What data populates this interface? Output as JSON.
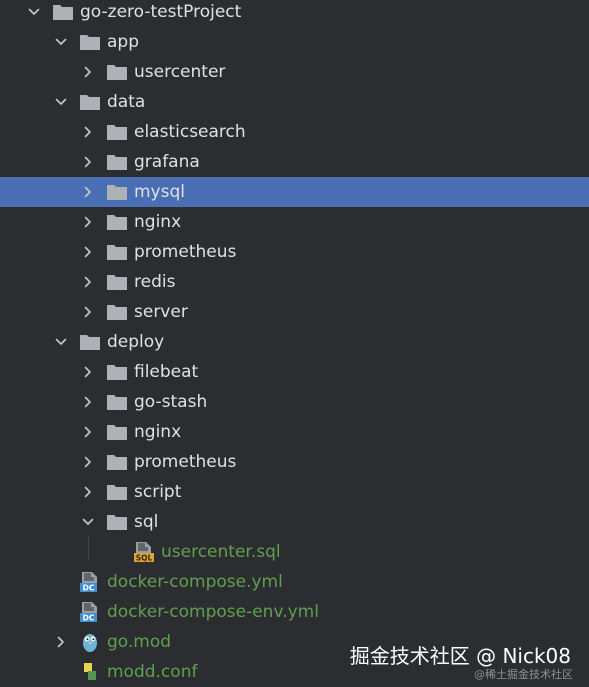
{
  "tree": [
    {
      "label": "go-zero-testProject",
      "depth": 0,
      "expanded": true,
      "type": "folder",
      "icon": "folder-icon"
    },
    {
      "label": "app",
      "depth": 1,
      "expanded": true,
      "type": "folder",
      "icon": "folder-icon"
    },
    {
      "label": "usercenter",
      "depth": 2,
      "expanded": false,
      "type": "folder",
      "icon": "folder-icon"
    },
    {
      "label": "data",
      "depth": 1,
      "expanded": true,
      "type": "folder",
      "icon": "folder-icon"
    },
    {
      "label": "elasticsearch",
      "depth": 2,
      "expanded": false,
      "type": "folder",
      "icon": "folder-icon"
    },
    {
      "label": "grafana",
      "depth": 2,
      "expanded": false,
      "type": "folder",
      "icon": "folder-icon"
    },
    {
      "label": "mysql",
      "depth": 2,
      "expanded": false,
      "type": "folder",
      "icon": "folder-icon",
      "selected": true
    },
    {
      "label": "nginx",
      "depth": 2,
      "expanded": false,
      "type": "folder",
      "icon": "folder-icon"
    },
    {
      "label": "prometheus",
      "depth": 2,
      "expanded": false,
      "type": "folder",
      "icon": "folder-icon"
    },
    {
      "label": "redis",
      "depth": 2,
      "expanded": false,
      "type": "folder",
      "icon": "folder-icon"
    },
    {
      "label": "server",
      "depth": 2,
      "expanded": false,
      "type": "folder",
      "icon": "folder-icon"
    },
    {
      "label": "deploy",
      "depth": 1,
      "expanded": true,
      "type": "folder",
      "icon": "folder-icon"
    },
    {
      "label": "filebeat",
      "depth": 2,
      "expanded": false,
      "type": "folder",
      "icon": "folder-icon"
    },
    {
      "label": "go-stash",
      "depth": 2,
      "expanded": false,
      "type": "folder",
      "icon": "folder-icon"
    },
    {
      "label": "nginx",
      "depth": 2,
      "expanded": false,
      "type": "folder",
      "icon": "folder-icon"
    },
    {
      "label": "prometheus",
      "depth": 2,
      "expanded": false,
      "type": "folder",
      "icon": "folder-icon"
    },
    {
      "label": "script",
      "depth": 2,
      "expanded": false,
      "type": "folder",
      "icon": "folder-icon"
    },
    {
      "label": "sql",
      "depth": 2,
      "expanded": true,
      "type": "folder",
      "icon": "folder-icon"
    },
    {
      "label": "usercenter.sql",
      "depth": 3,
      "type": "file",
      "icon": "sql-file-icon",
      "badge": "SQL",
      "green": true
    },
    {
      "label": "docker-compose.yml",
      "depth": 1,
      "type": "file",
      "icon": "docker-compose-file-icon",
      "badge": "DC",
      "green": true
    },
    {
      "label": "docker-compose-env.yml",
      "depth": 1,
      "type": "file",
      "icon": "docker-compose-file-icon",
      "badge": "DC",
      "green": true
    },
    {
      "label": "go.mod",
      "depth": 1,
      "expanded": false,
      "type": "module",
      "icon": "go-gopher-icon",
      "green": true
    },
    {
      "label": "modd.conf",
      "depth": 1,
      "type": "file",
      "icon": "config-file-icon",
      "green": true
    }
  ],
  "watermark": {
    "main": "掘金技术社区 @ Nick08",
    "sub": "@稀土掘金技术社区"
  },
  "colors": {
    "background": "#2b2d30",
    "selection": "#4a6eb4",
    "folder": "#aeb1b6",
    "vcs_added_green": "#5fa04e",
    "text": "#dfe1e5"
  }
}
